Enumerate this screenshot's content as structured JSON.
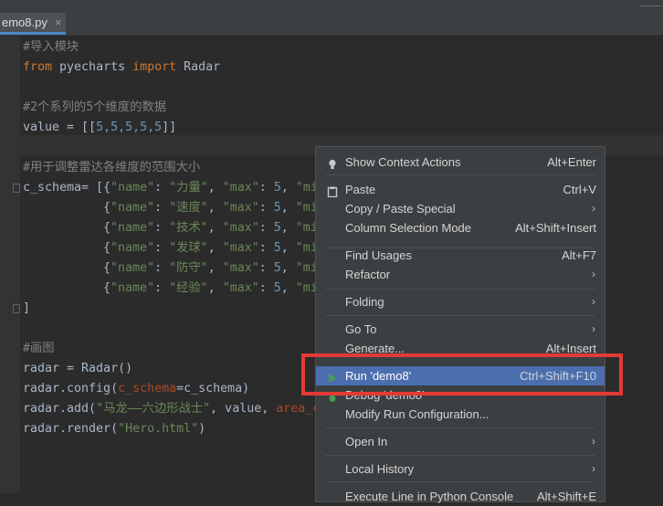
{
  "tab": {
    "label": "emo8.py",
    "close": "×"
  },
  "code": {
    "l1": "#导入模块",
    "l2_kw1": "from",
    "l2_mod": " pyecharts ",
    "l2_kw2": "import",
    "l2_name": " Radar",
    "l4": "#2个系列的5个维度的数据",
    "l5_a": "value = [[",
    "l5_nums": "5,5,5,5,5",
    "l5_b": "]]",
    "l7": "#用于调整雷达各维度的范围大小",
    "l8_a": "c_schema= [{",
    "l8_str": "\"name\"",
    "l8_b": ": ",
    "l8_val": "\"力量\"",
    "l8_c": ", ",
    "l8_max": "\"max\"",
    "l8_d": ": ",
    "l8_num": "5",
    "l8_e": ", ",
    "l8_mi": "\"mi",
    "rows": [
      {
        "val": "\"速度\""
      },
      {
        "val": "\"技术\""
      },
      {
        "val": "\"发球\""
      },
      {
        "val": "\"防守\""
      },
      {
        "val": "\"经验\""
      }
    ],
    "row_open": "{",
    "row_name": "\"name\"",
    "row_colon": ": ",
    "row_comma": ", ",
    "row_max": "\"max\"",
    "row_num": "5",
    "row_mi": "\"mi",
    "l15": "]",
    "l17": "#画图",
    "l18": "radar = Radar()",
    "l19_a": "radar.config(",
    "l19_p": "c_schema",
    "l19_b": "=c_schema)",
    "l20_a": "radar.add(",
    "l20_s": "\"马龙——六边形战士\"",
    "l20_b": ", value, ",
    "l20_p": "area_c",
    "l21_a": "radar.render(",
    "l21_s": "\"Hero.html\"",
    "l21_b": ")"
  },
  "menu": {
    "items": [
      {
        "label": "Show Context Actions",
        "shortcut": "Alt+Enter",
        "icon": "lightbulb-icon"
      },
      {
        "label": "Paste",
        "shortcut": "Ctrl+V",
        "icon": "clipboard-icon"
      },
      {
        "label": "Copy / Paste Special",
        "arrow": "›"
      },
      {
        "label": "Column Selection Mode",
        "shortcut": "Alt+Shift+Insert"
      },
      {
        "label": "Find Usages",
        "shortcut": "Alt+F7"
      },
      {
        "label": "Refactor",
        "arrow": "›"
      },
      {
        "label": "Folding",
        "arrow": "›"
      },
      {
        "label": "Go To",
        "arrow": "›"
      },
      {
        "label": "Generate...",
        "shortcut": "Alt+Insert"
      },
      {
        "label": "Run 'demo8'",
        "shortcut": "Ctrl+Shift+F10",
        "icon": "run-icon"
      },
      {
        "label": "Debug 'demo8'",
        "icon": "debug-icon"
      },
      {
        "label": "Modify Run Configuration..."
      },
      {
        "label": "Open In",
        "arrow": "›"
      },
      {
        "label": "Local History",
        "arrow": "›"
      },
      {
        "label": "Execute Line in Python Console",
        "shortcut": "Alt+Shift+E"
      }
    ]
  },
  "colors": {
    "selection": "#4b6eaf",
    "highlight_box": "#e53935",
    "run_icon": "#499c54"
  }
}
